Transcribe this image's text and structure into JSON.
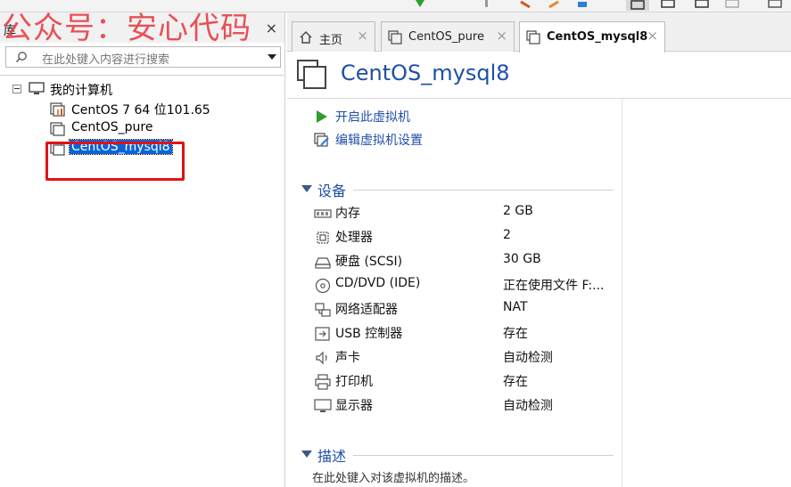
{
  "watermark": "公众号：安心代码",
  "library": {
    "title": "库",
    "close": "×",
    "search_placeholder": "在此处键入内容进行搜索",
    "tree": {
      "root": "我的计算机",
      "items": [
        {
          "label": "CentOS 7 64 位101.65",
          "icon": "vm-running-icon"
        },
        {
          "label": "CentOS_pure",
          "icon": "vm-icon"
        },
        {
          "label": "CentOS_mysql8",
          "icon": "vm-icon",
          "selected": true
        }
      ]
    }
  },
  "tabs": [
    {
      "label": "主页",
      "icon": "home-icon",
      "close": "×"
    },
    {
      "label": "CentOS_pure",
      "icon": "vm-icon",
      "close": "×"
    },
    {
      "label": "CentOS_mysql8",
      "icon": "vm-icon",
      "close": "×",
      "active": true
    }
  ],
  "vm": {
    "title": "CentOS_mysql8",
    "actions": [
      {
        "label": "开启此虚拟机",
        "icon": "play-icon"
      },
      {
        "label": "编辑虚拟机设置",
        "icon": "edit-settings-icon"
      }
    ],
    "devices_section": "设备",
    "devices": [
      {
        "name": "内存",
        "value": "2 GB",
        "icon": "memory-icon"
      },
      {
        "name": "处理器",
        "value": "2",
        "icon": "processor-icon"
      },
      {
        "name": "硬盘 (SCSI)",
        "value": "30 GB",
        "icon": "hard-disk-icon"
      },
      {
        "name": "CD/DVD (IDE)",
        "value": "正在使用文件 F:...",
        "icon": "cd-dvd-icon"
      },
      {
        "name": "网络适配器",
        "value": "NAT",
        "icon": "network-adapter-icon"
      },
      {
        "name": "USB 控制器",
        "value": "存在",
        "icon": "usb-icon"
      },
      {
        "name": "声卡",
        "value": "自动检测",
        "icon": "sound-card-icon"
      },
      {
        "name": "打印机",
        "value": "存在",
        "icon": "printer-icon"
      },
      {
        "name": "显示器",
        "value": "自动检测",
        "icon": "display-icon"
      }
    ],
    "description_section": "描述",
    "description_placeholder": "在此处键入对该虚拟机的描述。"
  },
  "colors": {
    "accent_blue": "#1f4fa8",
    "selection_blue": "#0a64d8",
    "highlight_red": "#e21212",
    "watermark_red": "#e8434a"
  }
}
